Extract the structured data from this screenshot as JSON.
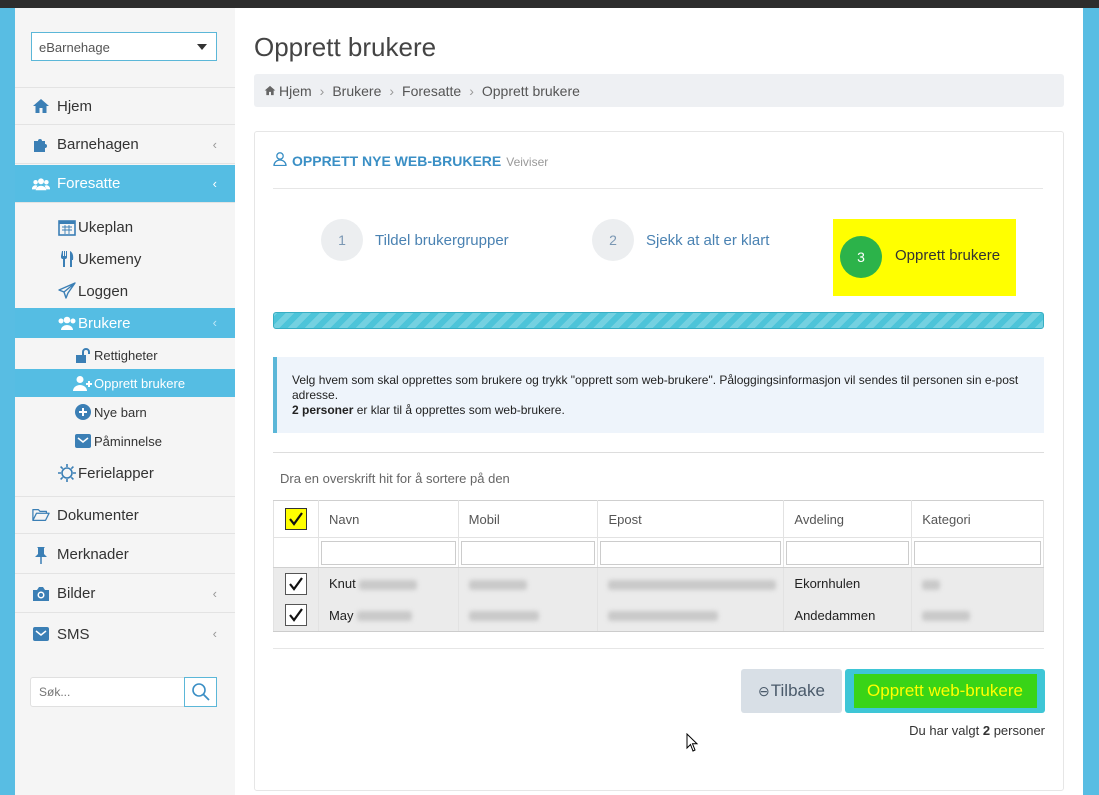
{
  "sidebar": {
    "org_select": "eBarnehage",
    "items": [
      {
        "label": "Hjem",
        "icon": "home-icon"
      },
      {
        "label": "Barnehagen",
        "icon": "puzzle-icon"
      },
      {
        "label": "Foresatte",
        "icon": "users-icon"
      }
    ],
    "sub_items": [
      {
        "label": "Ukeplan",
        "icon": "calendar-icon"
      },
      {
        "label": "Ukemeny",
        "icon": "utensils-icon"
      },
      {
        "label": "Loggen",
        "icon": "paper-plane-icon"
      },
      {
        "label": "Brukere",
        "icon": "users-icon"
      }
    ],
    "subsub_items": [
      {
        "label": "Rettigheter",
        "icon": "unlock-icon"
      },
      {
        "label": "Opprett brukere",
        "icon": "user-plus-icon"
      },
      {
        "label": "Nye barn",
        "icon": "plus-circle-icon"
      },
      {
        "label": "Påminnelse",
        "icon": "envelope-icon"
      }
    ],
    "sub_items_after": [
      {
        "label": "Ferielapper",
        "icon": "sun-icon"
      }
    ],
    "items_after": [
      {
        "label": "Dokumenter",
        "icon": "folder-icon"
      },
      {
        "label": "Merknader",
        "icon": "pin-icon"
      },
      {
        "label": "Bilder",
        "icon": "camera-icon"
      },
      {
        "label": "SMS",
        "icon": "envelope-icon"
      }
    ],
    "search_placeholder": "Søk..."
  },
  "page": {
    "title": "Opprett brukere",
    "breadcrumb": [
      "Hjem",
      "Brukere",
      "Foresatte",
      "Opprett brukere"
    ]
  },
  "wizard": {
    "heading": "OPPRETT NYE WEB-BRUKERE",
    "subheading": "Veiviser",
    "steps": [
      {
        "num": "1",
        "label": "Tildel brukergrupper"
      },
      {
        "num": "2",
        "label": "Sjekk at alt er klart"
      },
      {
        "num": "3",
        "label": "Opprett brukere"
      }
    ],
    "active_step": 3,
    "progress_percent": 100
  },
  "info": {
    "line1": "Velg hvem som skal opprettes som brukere og trykk \"opprett som web-brukere\". Påloggingsinformasjon vil sendes til personen sin e-post adresse.",
    "count_bold": "2 personer",
    "line2_rest": " er klar til å opprettes som web-brukere."
  },
  "grid": {
    "group_hint": "Dra en overskrift hit for å sortere på den",
    "columns": [
      "Navn",
      "Mobil",
      "Epost",
      "Avdeling",
      "Kategori"
    ],
    "rows": [
      {
        "first_name": "Knut",
        "avdeling": "Ekornhulen",
        "checked": true
      },
      {
        "first_name": "May",
        "avdeling": "Andedammen",
        "checked": true
      }
    ]
  },
  "actions": {
    "back_label": "Tilbake",
    "create_label": "Opprett web-brukere",
    "selected_prefix": "Du har valgt ",
    "selected_count": "2",
    "selected_suffix": " personer"
  },
  "colors": {
    "sidebar_active": "#55bde3",
    "highlight": "#ffff00",
    "create_button": "#39d417",
    "step_done": "#2cb34a",
    "progress": "#4dc4d9"
  }
}
